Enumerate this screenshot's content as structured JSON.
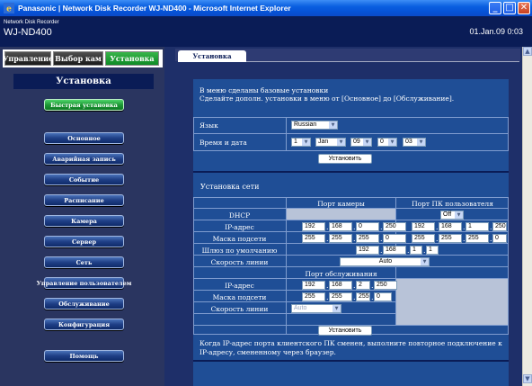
{
  "window": {
    "title": "Panasonic | Network Disk Recorder WJ-ND400 - Microsoft Internet Explorer"
  },
  "header": {
    "brand_small": "Network Disk Recorder",
    "brand_model": "WJ-ND400",
    "clock": "01.Jan.09  0:03"
  },
  "tabs": [
    "Управление",
    "Выбор кам",
    "Установка"
  ],
  "sidebar": {
    "heading": "Установка",
    "quick": "Быстрая установка",
    "items": [
      "Основное",
      "Аварийная запись",
      "Событие",
      "Расписание",
      "Камера",
      "Сервер",
      "Сеть",
      "Управление пользователем",
      "Обслуживание",
      "Конфигурация"
    ],
    "help": "Помощь"
  },
  "main": {
    "tab": "Установка",
    "intro_line1": "В меню сделаны базовые установки",
    "intro_line2": "Сделайте дополн. установки в меню от [Основное] до [Обслуживание].",
    "lang_label": "Язык",
    "lang_value": "Russian",
    "datetime_label": "Время и дата",
    "dt_day": "1",
    "dt_month": "Jan",
    "dt_year": "09",
    "dt_hour": "0",
    "dt_min": "03",
    "set_button": "Установить"
  },
  "network": {
    "title": "Установка сети",
    "col_camera": "Порт камеры",
    "col_pc": "Порт ПК пользователя",
    "dhcp_label": "DHCP",
    "dhcp_value": "Off",
    "ip_label": "IP-адрес",
    "mask_label": "Маска подсети",
    "gateway_label": "Шлюз по умолчанию",
    "speed_label": "Скорость линии",
    "speed_value": "Auto",
    "cam_ip": [
      "192",
      "168",
      "0",
      "250"
    ],
    "cam_mask": [
      "255",
      "255",
      "255",
      "0"
    ],
    "pc_ip": [
      "192",
      "168",
      "1",
      "250"
    ],
    "pc_mask": [
      "255",
      "255",
      "255",
      "0"
    ],
    "gateway": [
      "192",
      "168",
      "1",
      "1"
    ],
    "maint_header": "Порт обслуживания",
    "maint_ip_label": "IP-адрес",
    "maint_mask_label": "Маска подсети",
    "maint_speed_label": "Скорость линии",
    "maint_ip": [
      "192",
      "168",
      "2",
      "250"
    ],
    "maint_mask": [
      "255",
      "255",
      "255",
      "0"
    ],
    "maint_speed": "Auto",
    "set_button": "Установить",
    "note_line1": "Когда IP-адрес порта клиентского ПК сменен, выполните повторное подключение к",
    "note_line2": "IP-адресу, смененному через браузер."
  }
}
